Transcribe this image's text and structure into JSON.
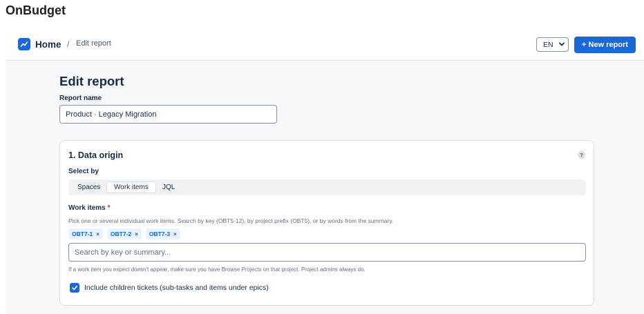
{
  "app": {
    "title": "OnBudget"
  },
  "breadcrumb": {
    "home": "Home",
    "separator": "/",
    "current": "Edit report"
  },
  "header": {
    "language": "EN",
    "new_report_label": "+ New report"
  },
  "page": {
    "title": "Edit report"
  },
  "report_name": {
    "label": "Report name",
    "value": "Product · Legacy Migration"
  },
  "data_origin": {
    "title": "1. Data origin",
    "help": "?",
    "select_by_label": "Select by",
    "tabs": [
      {
        "label": "Spaces",
        "active": false
      },
      {
        "label": "Work items",
        "active": true
      },
      {
        "label": "JQL",
        "active": false
      }
    ],
    "work_items_label": "Work items",
    "required_mark": "*",
    "work_items_hint": "Pick one or several individual work items. Search by key (OBT5-12), by project prefix (OBT5), or by words from the summary.",
    "chips": [
      {
        "label": "OBT7-1",
        "remove": "×"
      },
      {
        "label": "OBT7-2",
        "remove": "×"
      },
      {
        "label": "OBT7-3",
        "remove": "×"
      }
    ],
    "search_placeholder": "Search by key or summary...",
    "search_value": "",
    "search_hint": "If a work item you expect doesn't appear, make sure you have Browse Projects on that project. Project admins always do.",
    "include_children": {
      "label": "Include children tickets (sub-tasks and items under epics)",
      "checked": true
    }
  },
  "colors": {
    "accent": "#1868db",
    "chip_bg": "#e9f2ff",
    "chip_text": "#0c66e4",
    "required": "#c9372c"
  }
}
